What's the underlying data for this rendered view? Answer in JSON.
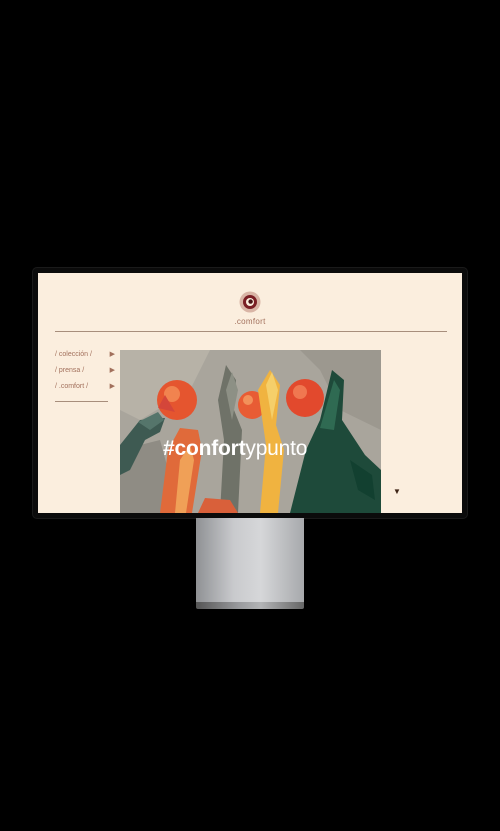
{
  "brand": {
    "name": ".comfort"
  },
  "menu": {
    "items": [
      {
        "label": "/ colección /",
        "arrow": "▶"
      },
      {
        "label": "/ prensa /",
        "arrow": "▶"
      },
      {
        "label": "/ .comfort /",
        "arrow": "▶"
      }
    ]
  },
  "hero": {
    "hashtag_bold": "#confort",
    "hashtag_light": "ypunto"
  },
  "scroll": {
    "arrow": "▼"
  },
  "colors": {
    "background": "#fbeede",
    "accent": "#a2705c",
    "logo_ring": "#7a1e24"
  }
}
